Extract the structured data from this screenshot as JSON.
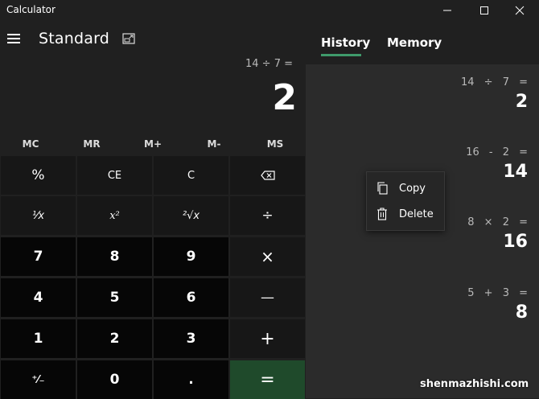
{
  "window": {
    "title": "Calculator"
  },
  "header": {
    "mode": "Standard"
  },
  "display": {
    "expression": "14 ÷ 7 =",
    "result": "2"
  },
  "memory_buttons": [
    "MC",
    "MR",
    "M+",
    "M-",
    "MS"
  ],
  "keys": {
    "percent": "%",
    "ce": "CE",
    "c": "C",
    "seven": "7",
    "eight": "8",
    "nine": "9",
    "four": "4",
    "five": "5",
    "six": "6",
    "one": "1",
    "two": "2",
    "three": "3",
    "zero": "0",
    "decimal": ".",
    "multiply": "×",
    "subtract": "—",
    "add": "+",
    "equals": "=",
    "divide": "÷",
    "reciprocal": "¹⁄x",
    "square": "x²",
    "sqrt": "²√x",
    "negate": "⁺⁄₋"
  },
  "tabs": {
    "history": "History",
    "memory": "Memory"
  },
  "history": [
    {
      "expression": "14 ÷ 7 =",
      "result": "2"
    },
    {
      "expression": "16 - 2 =",
      "result": "14"
    },
    {
      "expression": "8 × 2 =",
      "result": "16"
    },
    {
      "expression": "5 + 3 =",
      "result": "8"
    }
  ],
  "context_menu": {
    "copy": "Copy",
    "delete": "Delete"
  },
  "watermark": "shenmazhishi.com",
  "icons": {
    "menu": "hamburger-icon",
    "keep_on_top": "keep-on-top-icon",
    "backspace": "backspace-icon",
    "minimize": "minimize-icon",
    "maximize": "maximize-icon",
    "close": "close-icon",
    "copy": "copy-icon",
    "delete": "trash-icon"
  },
  "colors": {
    "background": "#202020",
    "accent": "#3f9a6b",
    "equals_key": "#1f4a2b",
    "history_panel": "#2b2b2b"
  }
}
